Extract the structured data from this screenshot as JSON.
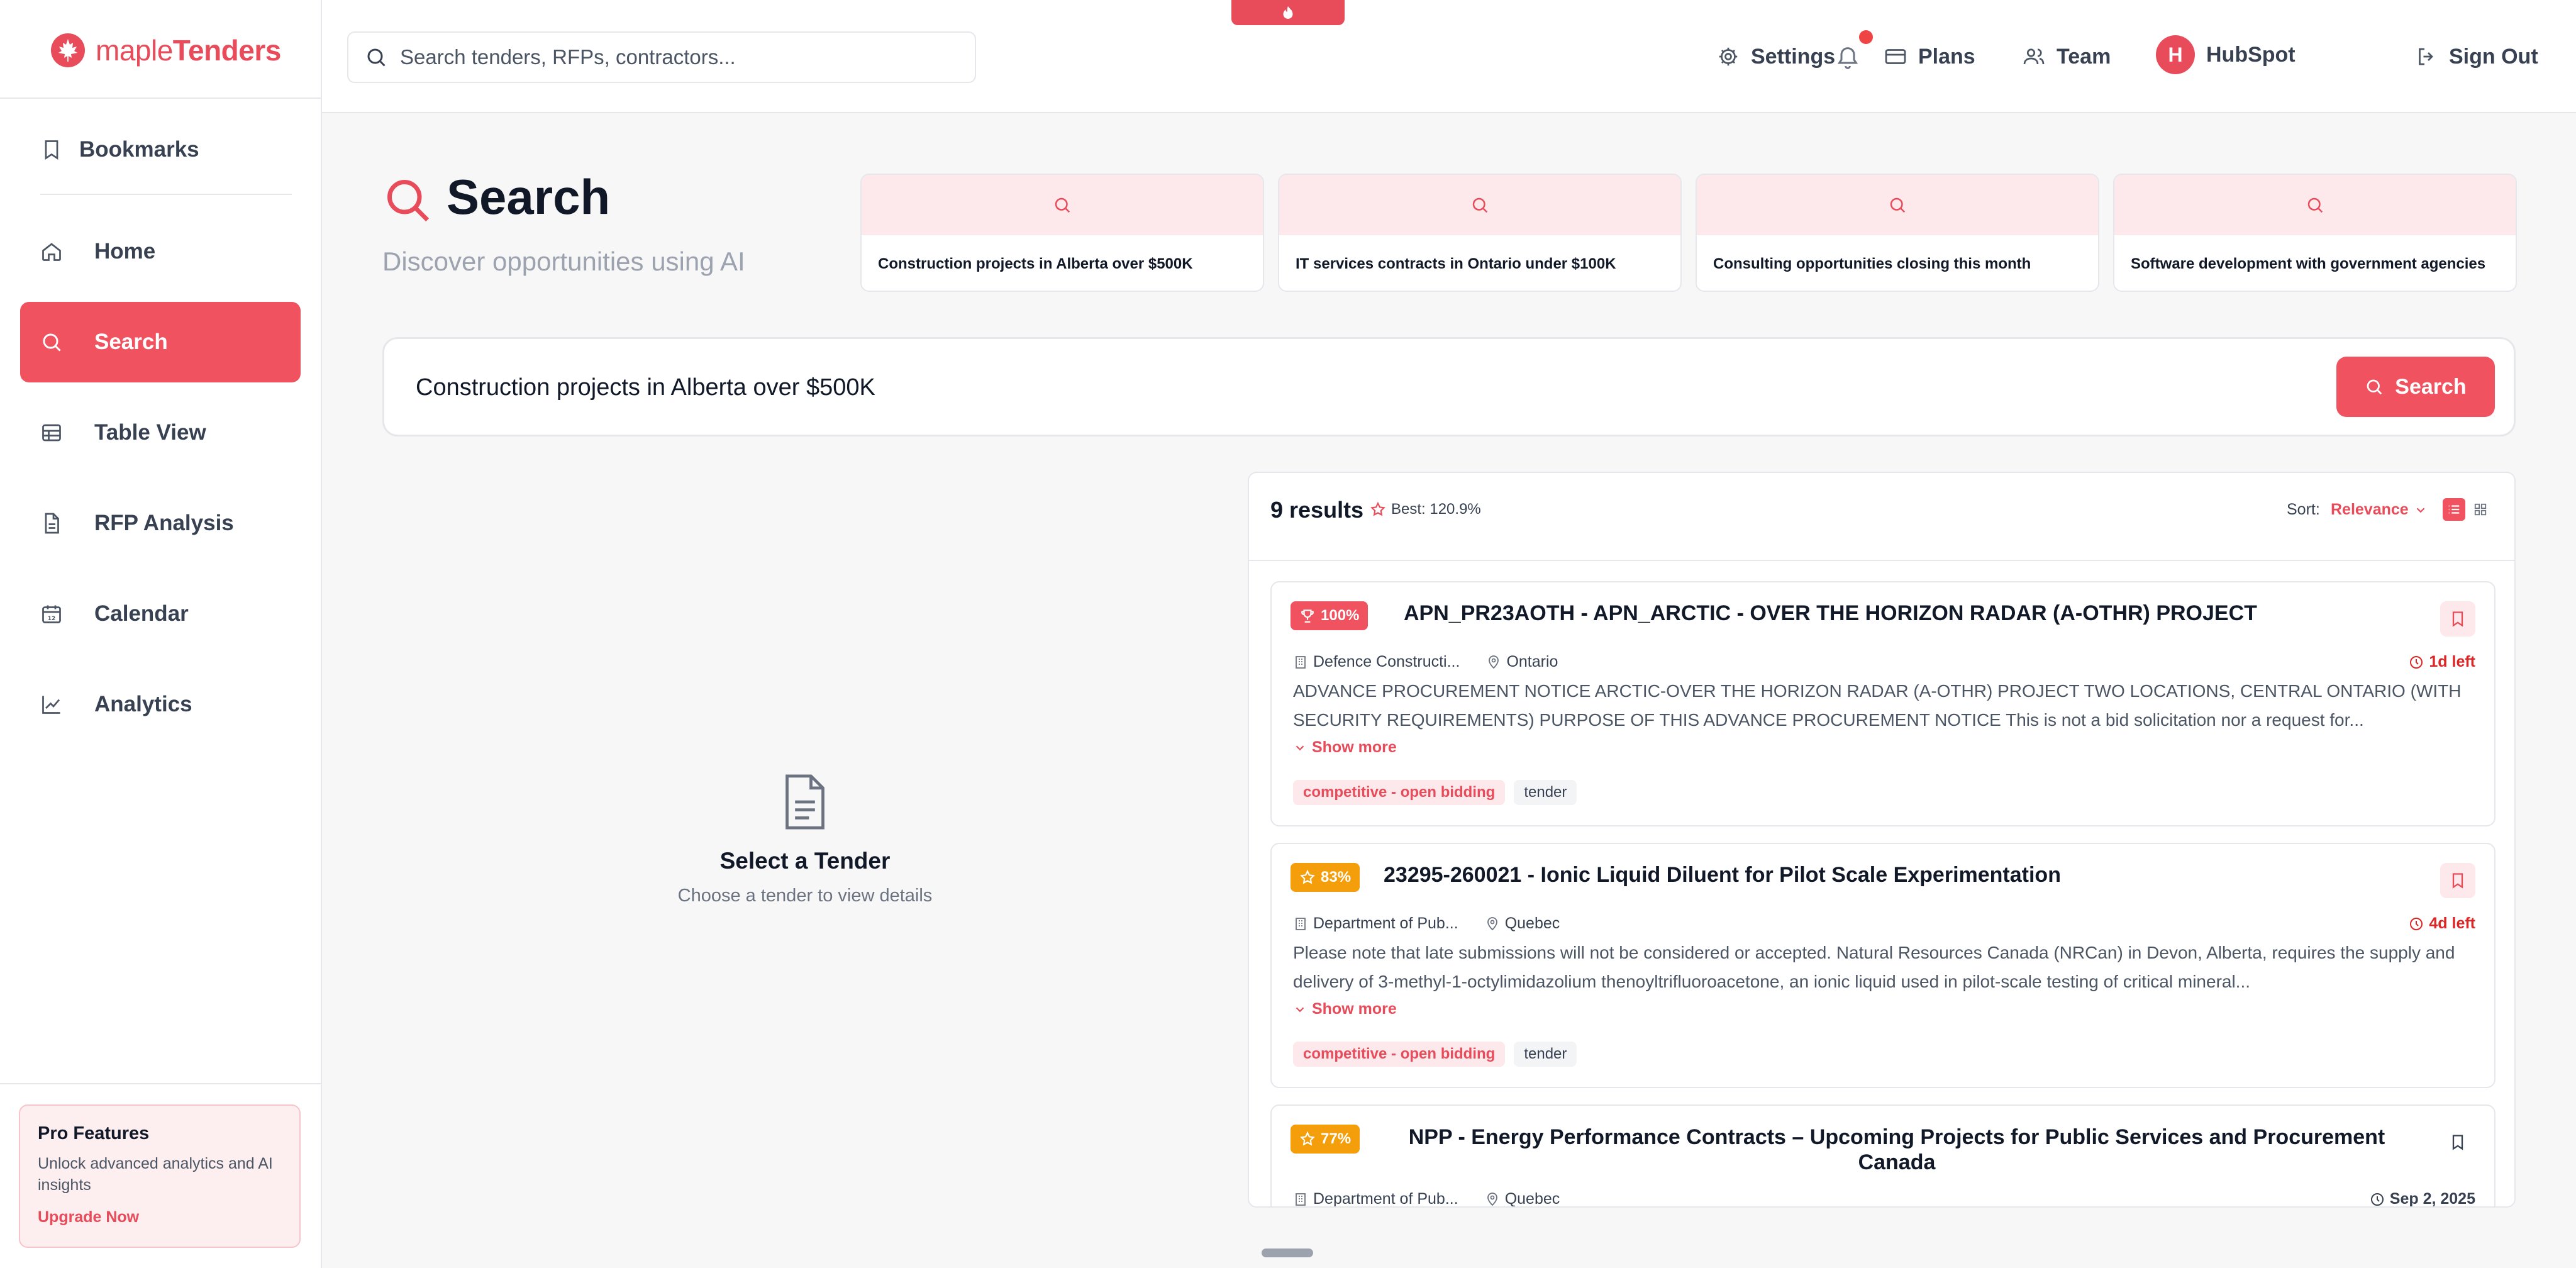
{
  "app": {
    "name_light": "maple",
    "name_bold": "Tenders"
  },
  "header": {
    "search_placeholder": "Search tenders, RFPs, contractors...",
    "settings": "Settings",
    "plans": "Plans",
    "team": "Team",
    "avatar_letter": "H",
    "user": "HubSpot",
    "sign_out": "Sign Out"
  },
  "sidebar": {
    "bookmarks": "Bookmarks",
    "items": [
      {
        "label": "Home",
        "icon": "home-icon"
      },
      {
        "label": "Search",
        "icon": "search-icon",
        "active": true
      },
      {
        "label": "Table View",
        "icon": "table-icon"
      },
      {
        "label": "RFP Analysis",
        "icon": "document-icon"
      },
      {
        "label": "Calendar",
        "icon": "calendar-icon"
      },
      {
        "label": "Analytics",
        "icon": "chart-line-icon"
      }
    ],
    "pro": {
      "title": "Pro Features",
      "description": "Unlock advanced analytics and AI insights",
      "cta": "Upgrade Now"
    }
  },
  "page": {
    "title": "Search",
    "subtitle": "Discover opportunities using AI",
    "suggestions": [
      "Construction projects in Alberta over $500K",
      "IT services contracts in Ontario under $100K",
      "Consulting opportunities closing this month",
      "Software development with government agencies"
    ],
    "query": "Construction projects in Alberta over $500K",
    "search_button": "Search"
  },
  "empty_state": {
    "title": "Select a Tender",
    "subtitle": "Choose a tender to view details"
  },
  "results": {
    "count": "9 results",
    "best": "Best: 120.9%",
    "sort_label": "Sort:",
    "sort_value": "Relevance",
    "items": [
      {
        "score": "100%",
        "title": "APN_PR23AOTH - APN_ARCTIC - OVER THE HORIZON RADAR (A-OTHR) PROJECT",
        "org": "Defence Constructi...",
        "location": "Ontario",
        "deadline": "1d left",
        "description": "ADVANCE PROCUREMENT NOTICE ARCTIC-OVER THE HORIZON RADAR (A-OTHR) PROJECT TWO LOCATIONS, CENTRAL ONTARIO (WITH SECURITY REQUIREMENTS) PURPOSE OF THIS ADVANCE PROCUREMENT NOTICE This is not a bid solicitation nor a request for...",
        "show_more": "Show more",
        "tags": [
          "competitive - open bidding",
          "tender"
        ]
      },
      {
        "score": "83%",
        "title": "23295-260021 - Ionic Liquid Diluent for Pilot Scale Experimentation",
        "org": "Department of Pub...",
        "location": "Quebec",
        "deadline": "4d left",
        "description": "Please note that late submissions will not be considered or accepted. Natural Resources Canada (NRCan) in Devon, Alberta, requires the supply and delivery of 3-methyl-1-octylimidazolium thenoyltrifluoroacetone, an ionic liquid used in pilot-scale testing of critical mineral...",
        "show_more": "Show more",
        "tags": [
          "competitive - open bidding",
          "tender"
        ]
      },
      {
        "score": "77%",
        "title": "NPP - Energy Performance Contracts – Upcoming Projects for Public Services and Procurement Canada",
        "org": "Department of Pub...",
        "location": "Quebec",
        "deadline": "Sep 2, 2025"
      }
    ]
  },
  "colors": {
    "accent": "#f0525f",
    "accent_soft": "#fde8eb",
    "orange": "#f59e0b"
  }
}
